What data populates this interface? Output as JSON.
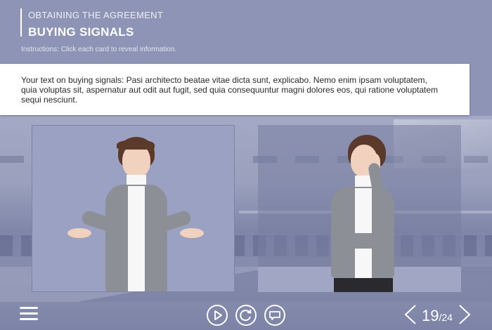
{
  "header": {
    "kicker": "OBTAINING THE AGREEMENT",
    "title": "BUYING SIGNALS",
    "instructions": "Instructions: Click each card to reveal information."
  },
  "panel": {
    "text": "Your text on buying signals: Pasi architecto beatae vitae dicta sunt, explicabo. Nemo enim ipsam voluptatem, quia voluptas sit, aspernatur aut odit aut fugit, sed quia consequuntur magni dolores eos, qui ratione voluptatem sequi nesciunt."
  },
  "cards": [
    {
      "name": "card-left",
      "state": "active"
    },
    {
      "name": "card-right",
      "state": "dimmed"
    }
  ],
  "controls": {
    "menu_icon": "hamburger-menu-icon",
    "play_icon": "play-icon",
    "replay_icon": "replay-icon",
    "comment_icon": "comment-icon",
    "prev_icon": "chevron-left-icon",
    "next_icon": "chevron-right-icon"
  },
  "pager": {
    "current": "19",
    "separator": "/",
    "total": "24"
  },
  "colors": {
    "background": "#8f95b6",
    "panel": "#ffffff",
    "text": "#2a2a2a",
    "accent": "#ffffff"
  }
}
